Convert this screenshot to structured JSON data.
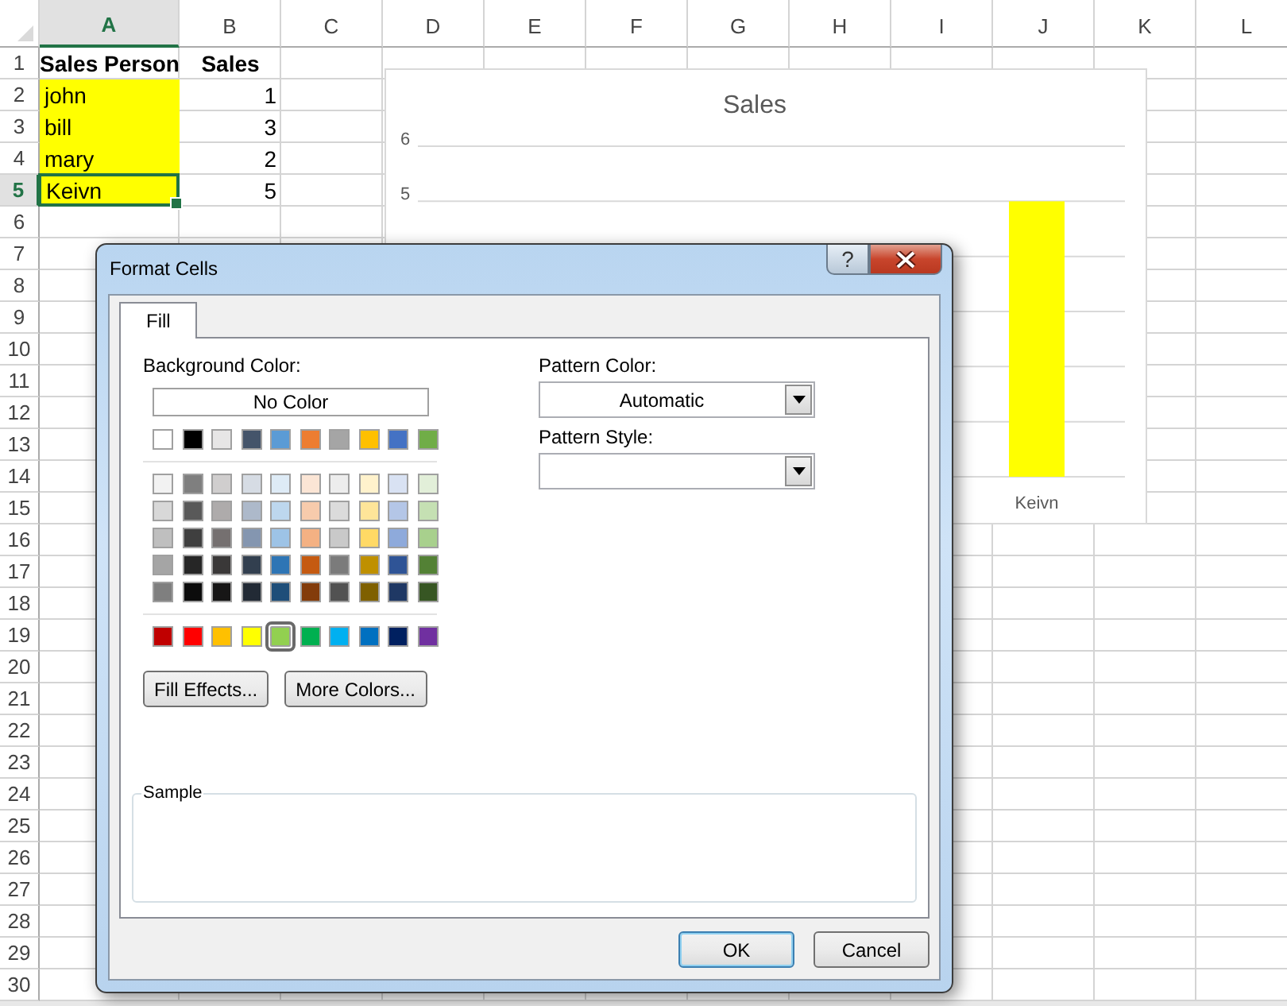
{
  "sheet": {
    "columns": [
      {
        "label": "A",
        "selected": true
      },
      {
        "label": "B",
        "selected": false
      },
      {
        "label": "C",
        "selected": false
      },
      {
        "label": "D",
        "selected": false
      },
      {
        "label": "E",
        "selected": false
      },
      {
        "label": "F",
        "selected": false
      },
      {
        "label": "G",
        "selected": false
      },
      {
        "label": "H",
        "selected": false
      },
      {
        "label": "I",
        "selected": false
      },
      {
        "label": "J",
        "selected": false
      },
      {
        "label": "K",
        "selected": false
      },
      {
        "label": "L",
        "selected": false
      }
    ],
    "rows": [
      {
        "header": "1",
        "selected": false,
        "cells": [
          {
            "kind": "heading",
            "text": "Sales Person",
            "selected": false
          },
          {
            "kind": "heading",
            "text": "Sales",
            "selected": false
          }
        ]
      },
      {
        "header": "2",
        "selected": false,
        "cells": [
          {
            "kind": "text",
            "text": "john",
            "color": "#ffff00",
            "selected": false
          },
          {
            "kind": "number",
            "text": "1",
            "selected": false
          }
        ]
      },
      {
        "header": "3",
        "selected": false,
        "cells": [
          {
            "kind": "text",
            "text": "bill",
            "color": "#ffff00",
            "selected": false
          },
          {
            "kind": "number",
            "text": "3",
            "selected": false
          }
        ]
      },
      {
        "header": "4",
        "selected": false,
        "cells": [
          {
            "kind": "text",
            "text": "mary",
            "color": "#ffff00",
            "selected": false
          },
          {
            "kind": "number",
            "text": "2",
            "selected": false
          }
        ]
      },
      {
        "header": "5",
        "selected": true,
        "cells": [
          {
            "kind": "text",
            "text": "Keivn",
            "color": "#ffff00",
            "selected": true
          },
          {
            "kind": "number",
            "text": "5",
            "selected": false
          }
        ]
      },
      {
        "header": "6",
        "selected": false
      },
      {
        "header": "7",
        "selected": false
      },
      {
        "header": "8",
        "selected": false
      },
      {
        "header": "9",
        "selected": false
      },
      {
        "header": "10",
        "selected": false
      },
      {
        "header": "11",
        "selected": false
      },
      {
        "header": "12",
        "selected": false
      },
      {
        "header": "13",
        "selected": false
      },
      {
        "header": "14",
        "selected": false
      },
      {
        "header": "15",
        "selected": false
      },
      {
        "header": "16",
        "selected": false
      },
      {
        "header": "17",
        "selected": false
      },
      {
        "header": "18",
        "selected": false
      },
      {
        "header": "19",
        "selected": false
      },
      {
        "header": "20",
        "selected": false
      },
      {
        "header": "21",
        "selected": false
      },
      {
        "header": "22",
        "selected": false
      },
      {
        "header": "23",
        "selected": false
      },
      {
        "header": "24",
        "selected": false
      },
      {
        "header": "25",
        "selected": false
      },
      {
        "header": "26",
        "selected": false
      },
      {
        "header": "27",
        "selected": false
      },
      {
        "header": "28",
        "selected": false
      },
      {
        "header": "29",
        "selected": false
      },
      {
        "header": "30",
        "selected": false
      }
    ]
  },
  "chart": {
    "chart_data": {
      "type": "bar",
      "title": "Sales",
      "categories": [
        "Keivn"
      ],
      "series": [
        {
          "color": "#ffff00",
          "values": [
            5
          ]
        }
      ],
      "ylim": [
        0,
        6
      ],
      "yticks": [
        5,
        6
      ]
    }
  },
  "dialog": {
    "title": "Format Cells",
    "help_button": "?",
    "tabs": [
      {
        "label": "Fill",
        "selected": true
      }
    ],
    "background_color": {
      "label": "Background Color:",
      "no_color_button": "No Color",
      "theme_colors": [
        {
          "color": "#ffffff",
          "selected": false
        },
        {
          "color": "#000000",
          "selected": false
        },
        {
          "color": "#e7e6e6",
          "selected": false
        },
        {
          "color": "#44546a",
          "selected": false
        },
        {
          "color": "#5b9bd5",
          "selected": false
        },
        {
          "color": "#ed7d31",
          "selected": false
        },
        {
          "color": "#a5a5a5",
          "selected": false
        },
        {
          "color": "#ffc000",
          "selected": false
        },
        {
          "color": "#4472c4",
          "selected": false
        },
        {
          "color": "#70ad47",
          "selected": false
        }
      ],
      "shades": [
        {
          "swatches": [
            {
              "color": "#f2f2f2",
              "selected": false
            },
            {
              "color": "#7f7f7f",
              "selected": false
            },
            {
              "color": "#d0cece",
              "selected": false
            },
            {
              "color": "#d6dce4",
              "selected": false
            },
            {
              "color": "#deebf6",
              "selected": false
            },
            {
              "color": "#fbe5d5",
              "selected": false
            },
            {
              "color": "#ededed",
              "selected": false
            },
            {
              "color": "#fff2cc",
              "selected": false
            },
            {
              "color": "#d9e2f3",
              "selected": false
            },
            {
              "color": "#e2efd9",
              "selected": false
            }
          ]
        },
        {
          "swatches": [
            {
              "color": "#d8d8d8",
              "selected": false
            },
            {
              "color": "#595959",
              "selected": false
            },
            {
              "color": "#aeabab",
              "selected": false
            },
            {
              "color": "#adb9ca",
              "selected": false
            },
            {
              "color": "#bdd7ee",
              "selected": false
            },
            {
              "color": "#f7cbac",
              "selected": false
            },
            {
              "color": "#dbdbdb",
              "selected": false
            },
            {
              "color": "#fee599",
              "selected": false
            },
            {
              "color": "#b4c6e7",
              "selected": false
            },
            {
              "color": "#c5e0b3",
              "selected": false
            }
          ]
        },
        {
          "swatches": [
            {
              "color": "#bfbfbf",
              "selected": false
            },
            {
              "color": "#3f3f3f",
              "selected": false
            },
            {
              "color": "#757070",
              "selected": false
            },
            {
              "color": "#8496b0",
              "selected": false
            },
            {
              "color": "#9dc3e6",
              "selected": false
            },
            {
              "color": "#f4b183",
              "selected": false
            },
            {
              "color": "#c9c9c9",
              "selected": false
            },
            {
              "color": "#ffd965",
              "selected": false
            },
            {
              "color": "#8eaadb",
              "selected": false
            },
            {
              "color": "#a8d08d",
              "selected": false
            }
          ]
        },
        {
          "swatches": [
            {
              "color": "#a5a5a5",
              "selected": false
            },
            {
              "color": "#262626",
              "selected": false
            },
            {
              "color": "#3a3838",
              "selected": false
            },
            {
              "color": "#323f4f",
              "selected": false
            },
            {
              "color": "#2e75b5",
              "selected": false
            },
            {
              "color": "#c55a11",
              "selected": false
            },
            {
              "color": "#7b7b7b",
              "selected": false
            },
            {
              "color": "#bf9000",
              "selected": false
            },
            {
              "color": "#2f5496",
              "selected": false
            },
            {
              "color": "#538135",
              "selected": false
            }
          ]
        },
        {
          "swatches": [
            {
              "color": "#7f7f7f",
              "selected": false
            },
            {
              "color": "#0c0c0c",
              "selected": false
            },
            {
              "color": "#171616",
              "selected": false
            },
            {
              "color": "#222a35",
              "selected": false
            },
            {
              "color": "#1e4e79",
              "selected": false
            },
            {
              "color": "#833c0b",
              "selected": false
            },
            {
              "color": "#525252",
              "selected": false
            },
            {
              "color": "#7f6000",
              "selected": false
            },
            {
              "color": "#1f3864",
              "selected": false
            },
            {
              "color": "#375623",
              "selected": false
            }
          ]
        }
      ],
      "standard_colors": [
        {
          "color": "#c00000",
          "selected": false
        },
        {
          "color": "#ff0000",
          "selected": false
        },
        {
          "color": "#ffc000",
          "selected": false
        },
        {
          "color": "#ffff00",
          "selected": false
        },
        {
          "color": "#92d050",
          "selected": true
        },
        {
          "color": "#00b050",
          "selected": false
        },
        {
          "color": "#00b0f0",
          "selected": false
        },
        {
          "color": "#0070c0",
          "selected": false
        },
        {
          "color": "#002060",
          "selected": false
        },
        {
          "color": "#7030a0",
          "selected": false
        }
      ],
      "buttons": [
        "Fill Effects...",
        "More Colors..."
      ]
    },
    "pattern_color": {
      "label": "Pattern Color:",
      "value": "Automatic"
    },
    "pattern_style": {
      "label": "Pattern Style:"
    },
    "sample": {
      "label": "Sample"
    },
    "footer_buttons": [
      {
        "label": "OK",
        "default": true
      },
      {
        "label": "Cancel",
        "default": false
      }
    ]
  }
}
